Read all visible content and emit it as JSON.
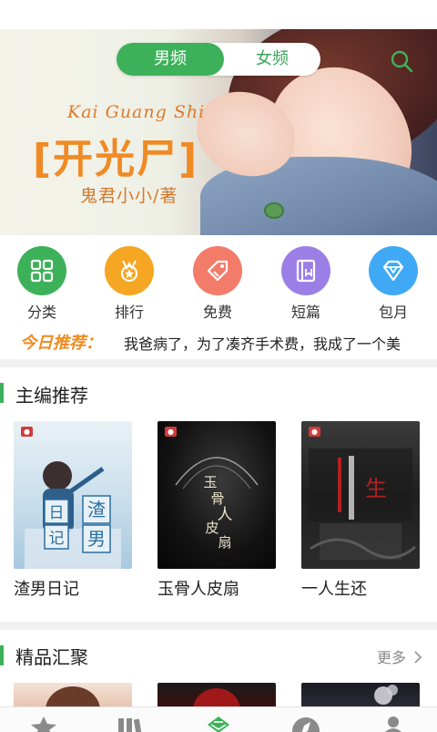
{
  "banner": {
    "roman_title": "Kai Guang Shi",
    "title": "[开光尸]",
    "author": "鬼君小小/著",
    "slides": 2,
    "active_slide": 1
  },
  "gender_toggle": {
    "options": [
      "男频",
      "女频"
    ],
    "selected": "男频"
  },
  "categories": [
    {
      "label": "分类",
      "icon": "grid-icon",
      "color": "#3db15a"
    },
    {
      "label": "排行",
      "icon": "medal-icon",
      "color": "#f5a623"
    },
    {
      "label": "免费",
      "icon": "tag-icon",
      "color": "#f37b6a"
    },
    {
      "label": "短篇",
      "icon": "book-icon",
      "color": "#9b7fe6"
    },
    {
      "label": "包月",
      "icon": "diamond-icon",
      "color": "#3fa9f5"
    }
  ],
  "today": {
    "tag": "今日推荐：",
    "text": "我爸病了，为了凑齐手术费，我成了一个美"
  },
  "editor_picks": {
    "title": "主编推荐",
    "books": [
      {
        "title": "渣男日记",
        "cover_text": "渣男日记"
      },
      {
        "title": "玉骨人皮扇",
        "cover_text": "玉骨人皮扇"
      },
      {
        "title": "一人生还",
        "cover_text": "一人生还"
      }
    ]
  },
  "premium": {
    "title": "精品汇聚",
    "more": "更多"
  },
  "tabbar": {
    "items": [
      "star-icon",
      "bookshelf-icon",
      "store-icon",
      "compass-icon",
      "user-icon"
    ],
    "active": 2
  },
  "colors": {
    "accent": "#3db15a",
    "highlight": "#f28a1e"
  }
}
